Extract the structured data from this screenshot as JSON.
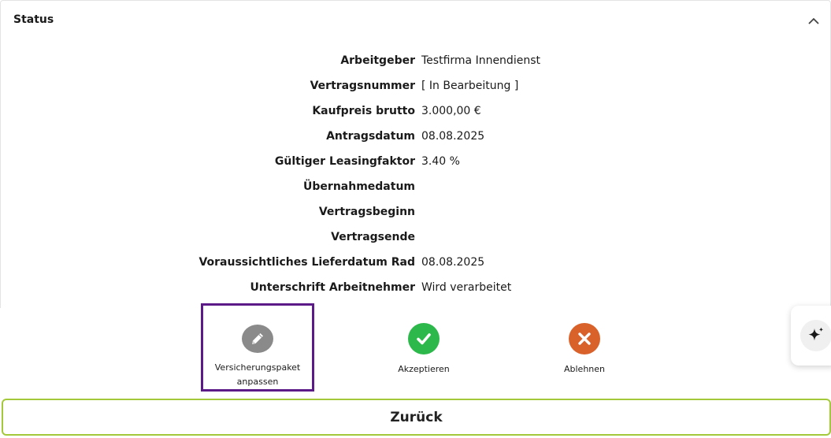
{
  "panel": {
    "title": "Status"
  },
  "details": [
    {
      "label": "Arbeitgeber",
      "value": "Testfirma Innendienst"
    },
    {
      "label": "Vertragsnummer",
      "value": "[ In Bearbeitung ]"
    },
    {
      "label": "Kaufpreis brutto",
      "value": "3.000,00 €"
    },
    {
      "label": "Antragsdatum",
      "value": "08.08.2025"
    },
    {
      "label": "Gültiger Leasingfaktor",
      "value": "3.40 %"
    },
    {
      "label": "Übernahmedatum",
      "value": ""
    },
    {
      "label": "Vertragsbeginn",
      "value": ""
    },
    {
      "label": "Vertragsende",
      "value": ""
    },
    {
      "label": "Voraussichtliches Lieferdatum Rad",
      "value": "08.08.2025"
    },
    {
      "label": "Unterschrift Arbeitnehmer",
      "value": "Wird verarbeitet"
    }
  ],
  "actions": {
    "edit": {
      "label_line1": "Versicherungspaket",
      "label_line2": "anpassen",
      "icon": "pencil-icon",
      "color": "#8a8a8a"
    },
    "accept": {
      "label": "Akzeptieren",
      "icon": "checkmark-icon",
      "color": "#2db84b"
    },
    "reject": {
      "label": "Ablehnen",
      "icon": "x-icon",
      "color": "#d9622b"
    }
  },
  "ai_button": {
    "icon": "sparkle-icon"
  },
  "back_button": {
    "label": "Zurück"
  },
  "colors": {
    "highlight_border": "#5b1a87",
    "back_border": "#a3c93a"
  }
}
